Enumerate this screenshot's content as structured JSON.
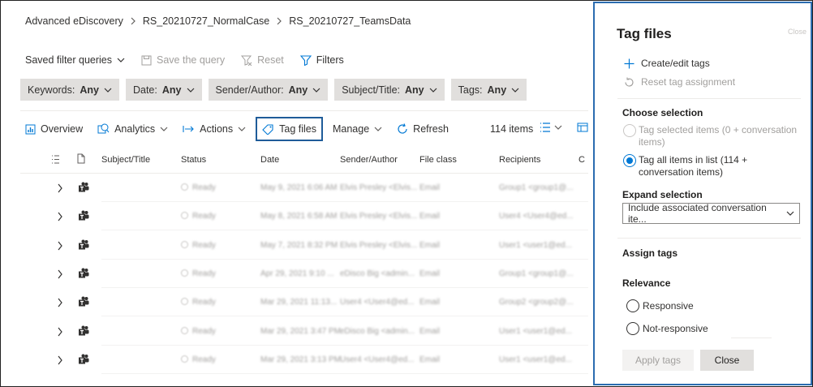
{
  "breadcrumb": {
    "items": [
      "Advanced eDiscovery",
      "RS_20210727_NormalCase",
      "RS_20210727_TeamsData"
    ]
  },
  "query_bar": {
    "saved_filter_queries": "Saved filter queries",
    "save_the_query": "Save the query",
    "reset": "Reset",
    "filters": "Filters"
  },
  "filters": [
    {
      "label": "Keywords:",
      "value": "Any"
    },
    {
      "label": "Date:",
      "value": "Any"
    },
    {
      "label": "Sender/Author:",
      "value": "Any"
    },
    {
      "label": "Subject/Title:",
      "value": "Any"
    },
    {
      "label": "Tags:",
      "value": "Any"
    }
  ],
  "commands": {
    "overview": "Overview",
    "analytics": "Analytics",
    "actions": "Actions",
    "tag_files": "Tag files",
    "manage": "Manage",
    "refresh": "Refresh"
  },
  "item_count": "114 items",
  "columns": {
    "subject": "Subject/Title",
    "status": "Status",
    "date": "Date",
    "sender": "Sender/Author",
    "file_class": "File class",
    "recipients": "Recipients",
    "more": "C"
  },
  "rows": [
    {
      "status": "Ready",
      "date": "May 9, 2021 6:06 AM",
      "sender": "Elvis Presley <Elvis...",
      "file_class": "Email",
      "recipients": "Group1 <group1@..."
    },
    {
      "status": "Ready",
      "date": "May 8, 2021 6:58 AM",
      "sender": "Elvis Presley <Elvis...",
      "file_class": "Email",
      "recipients": "User4 <User4@ed..."
    },
    {
      "status": "Ready",
      "date": "May 7, 2021 8:32 PM",
      "sender": "Elvis Presley <Elvis...",
      "file_class": "Email",
      "recipients": "User1 <user1@ed..."
    },
    {
      "status": "Ready",
      "date": "Apr 29, 2021 9:10 ...",
      "sender": "eDisco Big <admin...",
      "file_class": "Email",
      "recipients": "Group1 <group1@..."
    },
    {
      "status": "Ready",
      "date": "Mar 29, 2021 11:13...",
      "sender": "User4 <User4@ed...",
      "file_class": "Email",
      "recipients": "Group2 <group2@..."
    },
    {
      "status": "Ready",
      "date": "Mar 29, 2021 3:47 PM",
      "sender": "eDisco Big <admin...",
      "file_class": "Email",
      "recipients": "User1 <user1@ed..."
    },
    {
      "status": "Ready",
      "date": "Mar 29, 2021 3:13 PM",
      "sender": "User4 <User4@ed...",
      "file_class": "Email",
      "recipients": "User1 <user1@ed..."
    }
  ],
  "panel": {
    "title": "Tag files",
    "close_hint": "Close",
    "create_edit_tags": "Create/edit tags",
    "reset_tag_assignment": "Reset tag assignment",
    "choose_selection": "Choose selection",
    "tag_selected": "Tag selected items (0 + conversation items)",
    "tag_all": "Tag all items in list (114 + conversation items)",
    "expand_selection": "Expand selection",
    "expand_value": "Include associated conversation ite...",
    "assign_tags": "Assign tags",
    "relevance": "Relevance",
    "responsive": "Responsive",
    "not_responsive": "Not-responsive",
    "apply_tags": "Apply tags",
    "close": "Close"
  },
  "colors": {
    "accent": "#0078d4",
    "panel_border": "#2b6cb0",
    "chip_bg": "#e1dfdd"
  }
}
